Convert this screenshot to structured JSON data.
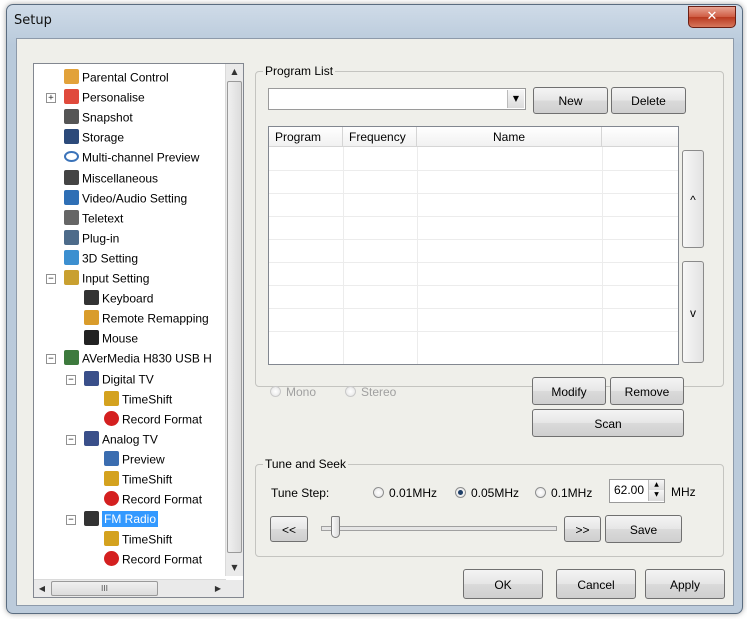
{
  "window": {
    "title": "Setup",
    "close_glyph": "✕"
  },
  "tree": {
    "items": [
      {
        "label": "Parental Control",
        "icon": "lock-icon"
      },
      {
        "label": "Personalise",
        "icon": "palette-icon"
      },
      {
        "label": "Snapshot",
        "icon": "camera-icon"
      },
      {
        "label": "Storage",
        "icon": "floppy-icon"
      },
      {
        "label": "Multi-channel Preview",
        "icon": "eye-icon"
      },
      {
        "label": "Miscellaneous",
        "icon": "pen-icon"
      },
      {
        "label": "Video/Audio Setting",
        "icon": "tools-icon"
      },
      {
        "label": "Teletext",
        "icon": "text-icon"
      },
      {
        "label": "Plug-in",
        "icon": "plugin-icon"
      },
      {
        "label": "3D Setting",
        "icon": "gear-icon"
      },
      {
        "label": "Input Setting",
        "icon": "input-icon"
      },
      {
        "label": "Keyboard",
        "icon": "keyboard-icon"
      },
      {
        "label": "Remote Remapping",
        "icon": "remote-icon"
      },
      {
        "label": "Mouse",
        "icon": "mouse-icon"
      },
      {
        "label": "AVerMedia H830 USB H",
        "icon": "device-icon"
      },
      {
        "label": "Digital TV",
        "icon": "tv-icon"
      },
      {
        "label": "TimeShift",
        "icon": "timeshift-icon"
      },
      {
        "label": "Record Format",
        "icon": "record-icon"
      },
      {
        "label": "Analog TV",
        "icon": "tv-icon"
      },
      {
        "label": "Preview",
        "icon": "preview-icon"
      },
      {
        "label": "TimeShift",
        "icon": "timeshift-icon"
      },
      {
        "label": "Record Format",
        "icon": "record-icon"
      },
      {
        "label": "FM Radio",
        "icon": "radio-icon"
      },
      {
        "label": "TimeShift",
        "icon": "timeshift-icon"
      },
      {
        "label": "Record Format",
        "icon": "record-icon"
      }
    ],
    "selected": "FM Radio",
    "hscroll_glyph": "III",
    "expanders": {
      "plus": "+",
      "minus": "−"
    },
    "arrows": {
      "up": "▲",
      "down": "▼",
      "left": "◀",
      "right": "▶"
    }
  },
  "program_list": {
    "group_title": "Program List",
    "combo_value": "",
    "new_label": "New",
    "delete_label": "Delete",
    "columns": [
      "Program",
      "Frequency",
      "Name",
      ""
    ],
    "up_label": "^",
    "down_label": "v",
    "mono_label": "Mono",
    "stereo_label": "Stereo",
    "modify_label": "Modify",
    "remove_label": "Remove",
    "scan_label": "Scan"
  },
  "tune": {
    "group_title": "Tune and Seek",
    "step_label": "Tune Step:",
    "options": [
      "0.01MHz",
      "0.05MHz",
      "0.1MHz"
    ],
    "selected_option": "0.05MHz",
    "frequency": "62.00",
    "unit": "MHz",
    "back_label": "<<",
    "forward_label": ">>",
    "save_label": "Save",
    "slider_position": 0
  },
  "footer": {
    "ok_label": "OK",
    "cancel_label": "Cancel",
    "apply_label": "Apply"
  },
  "colors": {
    "selection": "#3399ff",
    "close_button": "#c9503a"
  }
}
